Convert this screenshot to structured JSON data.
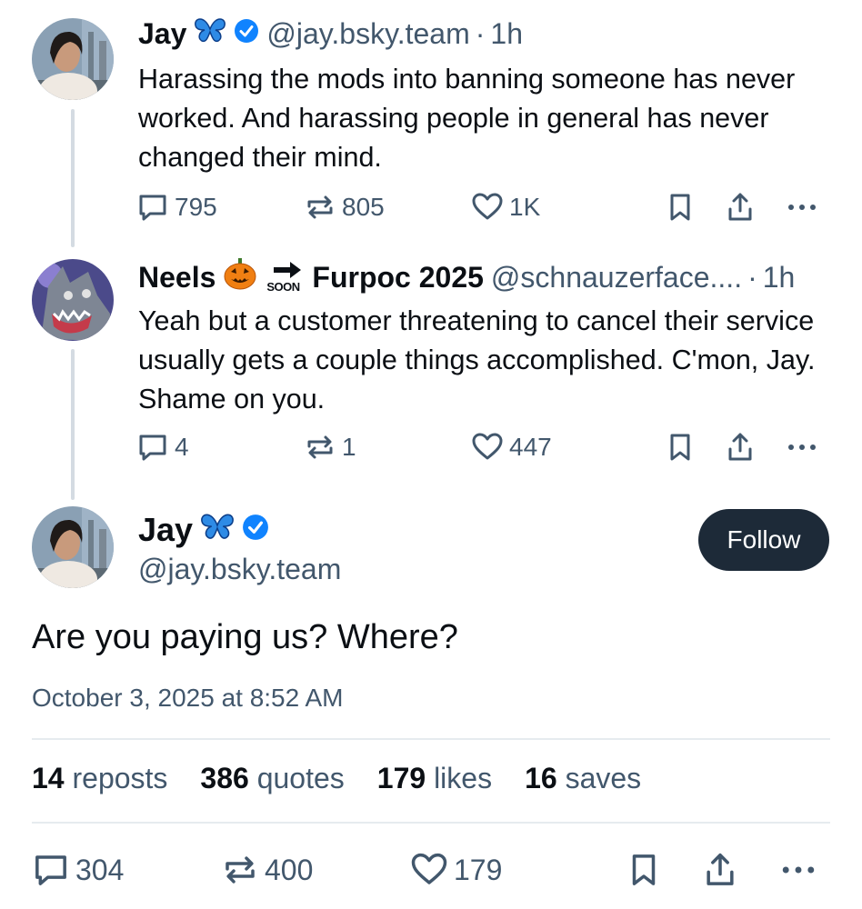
{
  "colors": {
    "accent": "#1083fe",
    "text": "#0b0f14",
    "muted": "#42576c",
    "follow_bg": "#1d2a38"
  },
  "posts": [
    {
      "author": "Jay",
      "handle": "@jay.bsky.team",
      "time": "1h",
      "badges": [
        "butterfly-emoji",
        "verified-check-icon"
      ],
      "text": "Harassing the mods into banning someone has never worked. And harassing people in general has never changed their mind.",
      "replies": "795",
      "reposts": "805",
      "likes": "1K"
    },
    {
      "author": "Neels",
      "author_suffix": "Furpoc 2025",
      "soon": "SOON",
      "handle": "@schnauzerface....",
      "time": "1h",
      "badges": [
        "jack-o-lantern-emoji",
        "soon-arrow-emoji"
      ],
      "text": "Yeah but a customer threatening to cancel their service usually gets a couple things accomplished. C'mon, Jay. Shame on you.",
      "replies": "4",
      "reposts": "1",
      "likes": "447"
    }
  ],
  "main_post": {
    "author": "Jay",
    "handle": "@jay.bsky.team",
    "follow_label": "Follow",
    "text": "Are you paying us? Where?",
    "date": "October 3, 2025 at 8:52 AM",
    "stats": [
      {
        "value": "14",
        "label": "reposts"
      },
      {
        "value": "386",
        "label": "quotes"
      },
      {
        "value": "179",
        "label": "likes"
      },
      {
        "value": "16",
        "label": "saves"
      }
    ],
    "replies": "304",
    "reposts": "400",
    "likes": "179"
  }
}
